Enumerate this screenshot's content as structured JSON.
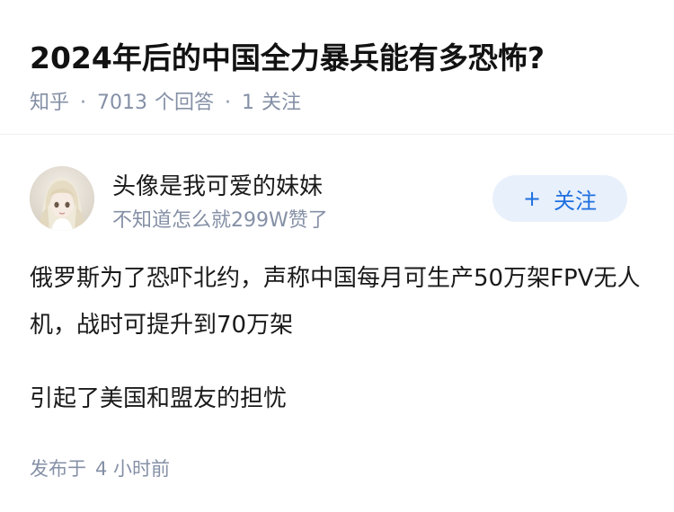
{
  "question": {
    "title": "2024年后的中国全力暴兵能有多恐怖?",
    "source": "知乎",
    "answer_count": "7013",
    "answer_label": "个回答",
    "follow_count": "1",
    "follow_label": "关注"
  },
  "answer": {
    "author_name": "头像是我可爱的妹妹",
    "author_desc": "不知道怎么就299W赞了",
    "follow_button": "关注",
    "follow_icon": "plus-icon",
    "paragraphs": [
      "俄罗斯为了恐吓北约，声称中国每月可生产50万架FPV无人机，战时可提升到70万架",
      "引起了美国和盟友的担忧"
    ],
    "published_label": "发布于",
    "published_time": "4 小时前"
  },
  "colors": {
    "text": "#1a1a1a",
    "meta": "#8590a6",
    "accent": "#1e6fe0",
    "button_bg": "#e8f0fb"
  }
}
